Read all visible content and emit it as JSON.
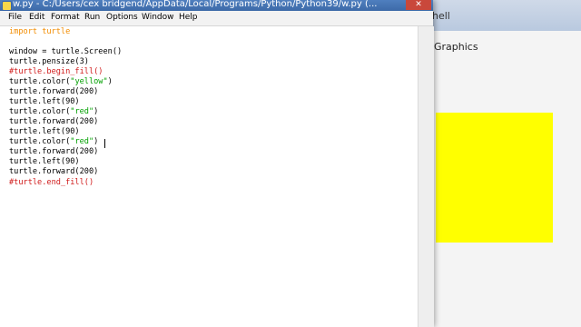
{
  "background_window": {
    "title": "hell",
    "subtitle": "Graphics",
    "canvas_fill_color": "#ffff00"
  },
  "editor": {
    "title": "w.py - C:/Users/cex bridgend/AppData/Local/Programs/Python/Python39/w.py (...",
    "close_icon": "close-icon",
    "menu": [
      "File",
      "Edit",
      "Format",
      "Run",
      "Options",
      "Window",
      "Help"
    ],
    "code_lines": [
      "import turtle",
      "",
      "window = turtle.Screen()",
      "turtle.pensize(3)",
      "#turtle.begin_fill()",
      "turtle.color(\"yellow\")",
      "turtle.forward(200)",
      "turtle.left(90)",
      "turtle.color(\"red\")",
      "turtle.forward(200)",
      "turtle.left(90)",
      "turtle.color(\"red\")",
      "turtle.forward(200)",
      "turtle.left(90)",
      "turtle.forward(200)",
      "#turtle.end_fill()"
    ],
    "syntax_colors": {
      "keyword": "#f28c00",
      "string": "#00a000",
      "comment": "#d01a1a"
    }
  }
}
